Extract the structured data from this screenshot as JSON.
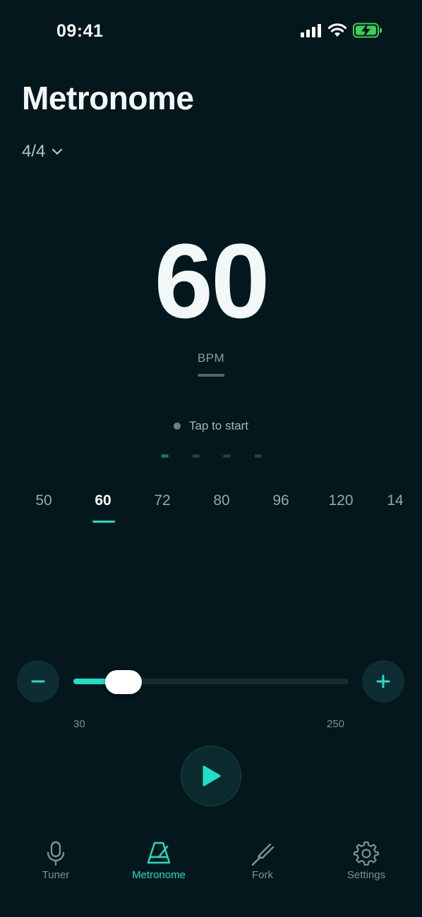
{
  "status": {
    "time": "09:41"
  },
  "header": {
    "title": "Metronome",
    "time_signature": "4/4"
  },
  "tempo": {
    "value": "60",
    "unit": "BPM",
    "hint": "Tap to start"
  },
  "beats": {
    "count": 4,
    "active_index": 0
  },
  "presets": [
    {
      "label": "50"
    },
    {
      "label": "60",
      "selected": true
    },
    {
      "label": "72"
    },
    {
      "label": "80"
    },
    {
      "label": "96"
    },
    {
      "label": "120"
    },
    {
      "label": "14"
    }
  ],
  "slider": {
    "min": "30",
    "max": "250",
    "value": 60
  },
  "tabs": [
    {
      "label": "Tuner",
      "icon": "microphone-icon"
    },
    {
      "label": "Metronome",
      "icon": "metronome-icon",
      "active": true
    },
    {
      "label": "Fork",
      "icon": "tuning-fork-icon"
    },
    {
      "label": "Settings",
      "icon": "gear-icon"
    }
  ],
  "colors": {
    "accent": "#1fe0c7",
    "background": "#04171c"
  }
}
